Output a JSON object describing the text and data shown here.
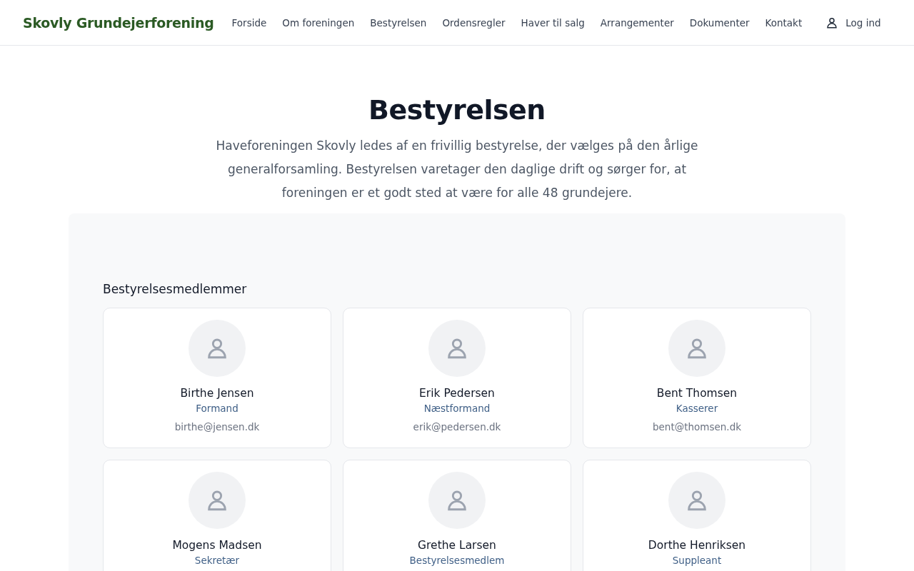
{
  "header": {
    "brand": "Skovly Grundejerforening",
    "nav": [
      {
        "label": "Forside"
      },
      {
        "label": "Om foreningen"
      },
      {
        "label": "Bestyrelsen"
      },
      {
        "label": "Ordensregler"
      },
      {
        "label": "Haver til salg"
      },
      {
        "label": "Arrangementer"
      },
      {
        "label": "Dokumenter"
      },
      {
        "label": "Kontakt"
      }
    ],
    "login": "Log ind"
  },
  "page": {
    "title": "Bestyrelsen",
    "intro": "Haveforeningen Skovly ledes af en frivillig bestyrelse, der vælges på den årlige generalforsamling. Bestyrelsen varetager den daglige drift og sørger for, at foreningen er et godt sted at være for alle 48 grundejere."
  },
  "members": {
    "heading": "Bestyrelsesmedlemmer",
    "items": [
      {
        "name": "Birthe Jensen",
        "role": "Formand",
        "email": "birthe@jensen.dk"
      },
      {
        "name": "Erik Pedersen",
        "role": "Næstformand",
        "email": "erik@pedersen.dk"
      },
      {
        "name": "Bent Thomsen",
        "role": "Kasserer",
        "email": "bent@thomsen.dk"
      },
      {
        "name": "Mogens Madsen",
        "role": "Sekretær"
      },
      {
        "name": "Grethe Larsen",
        "role": "Bestyrelsesmedlem"
      },
      {
        "name": "Dorthe Henriksen",
        "role": "Suppleant"
      }
    ]
  }
}
